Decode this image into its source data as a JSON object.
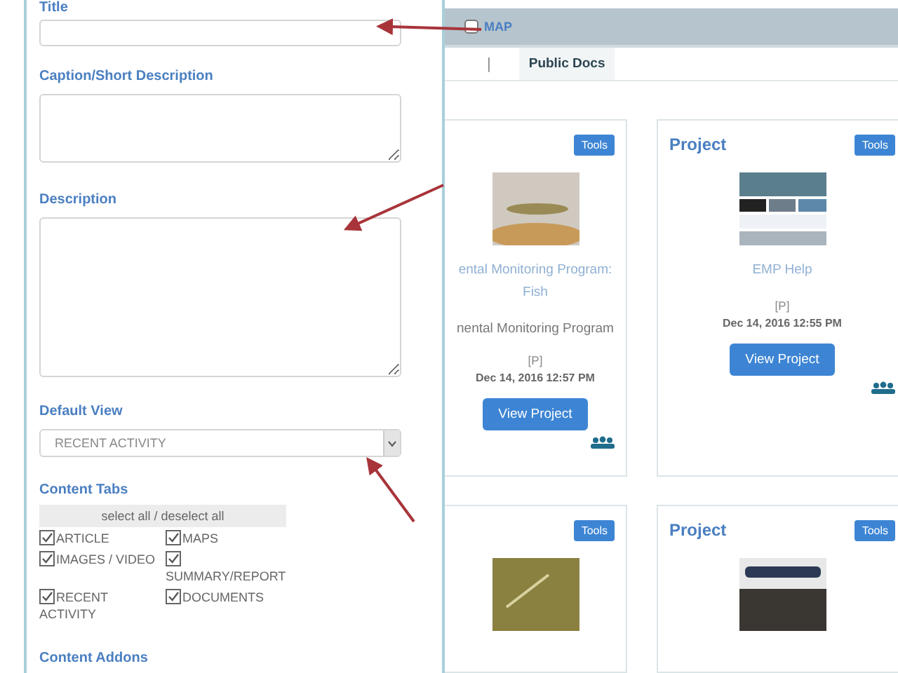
{
  "drawer": {
    "title_field": {
      "label": "Title"
    },
    "caption_field": {
      "label": "Caption/Short Description"
    },
    "description_field": {
      "label": "Description"
    },
    "default_view": {
      "label": "Default View",
      "value": "RECENT ACTIVITY"
    },
    "content_tabs": {
      "label": "Content Tabs",
      "select_all": "select all / deselect all",
      "options": [
        {
          "label": "ARTICLE",
          "checked": true
        },
        {
          "label": "MAPS",
          "checked": true
        },
        {
          "label": "IMAGES / VIDEO",
          "checked": true
        },
        {
          "label": "SUMMARY/REPORT",
          "checked": true
        },
        {
          "label": "RECENT ACTIVITY",
          "checked": true
        },
        {
          "label": "DOCUMENTS",
          "checked": true
        }
      ]
    },
    "content_addons": {
      "label": "Content Addons"
    }
  },
  "filter_bar": {
    "map": {
      "label": "MAP",
      "checked": false
    }
  },
  "tab_bar": {
    "separator": "|",
    "tabs": [
      {
        "label": "Public Docs",
        "selected": true
      }
    ]
  },
  "cards": [
    {
      "tools": "Tools",
      "name": "ental Monitoring Program:",
      "name_line2": "Fish",
      "description": "nental Monitoring Program",
      "access": "[P]",
      "date": "Dec 14, 2016 12:57 PM",
      "button": "View Project"
    },
    {
      "title": "Project",
      "tools": "Tools",
      "name": "EMP Help",
      "access": "[P]",
      "date": "Dec 14, 2016 12:55 PM",
      "button": "View Project"
    },
    {
      "tools": "Tools"
    },
    {
      "title": "Project",
      "tools": "Tools"
    }
  ]
}
